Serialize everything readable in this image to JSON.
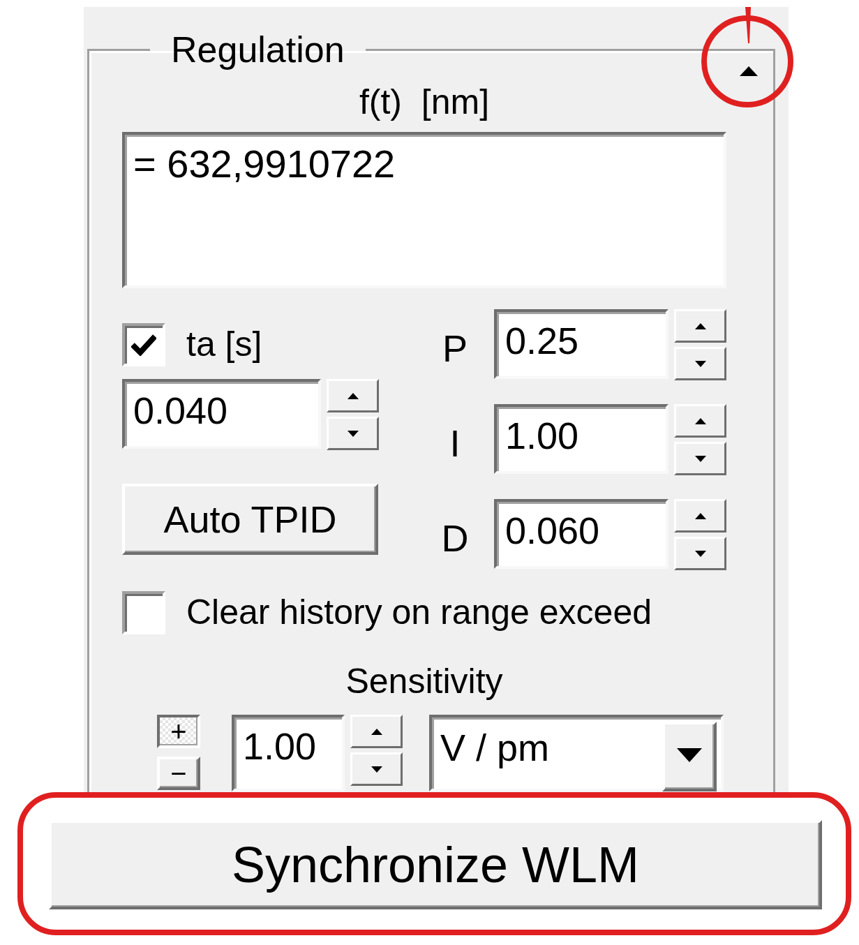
{
  "group": {
    "title": "Regulation",
    "expanded": true
  },
  "formula": {
    "label": "f(t)  [nm]",
    "value": "= 632,9910722"
  },
  "ta": {
    "label": "ta [s]",
    "checked": true,
    "value": "0.040"
  },
  "auto_button": "Auto TPID",
  "pid": [
    {
      "label": "P",
      "value": "0.25"
    },
    {
      "label": "I",
      "value": "1.00"
    },
    {
      "label": "D",
      "value": "0.060"
    }
  ],
  "clear_history": {
    "label": "Clear history on range exceed",
    "checked": false
  },
  "sensitivity": {
    "label": "Sensitivity",
    "step_buttons": [
      "+",
      "−"
    ],
    "value": "1.00",
    "unit": "V / pm"
  },
  "sync_button": "Synchronize WLM"
}
